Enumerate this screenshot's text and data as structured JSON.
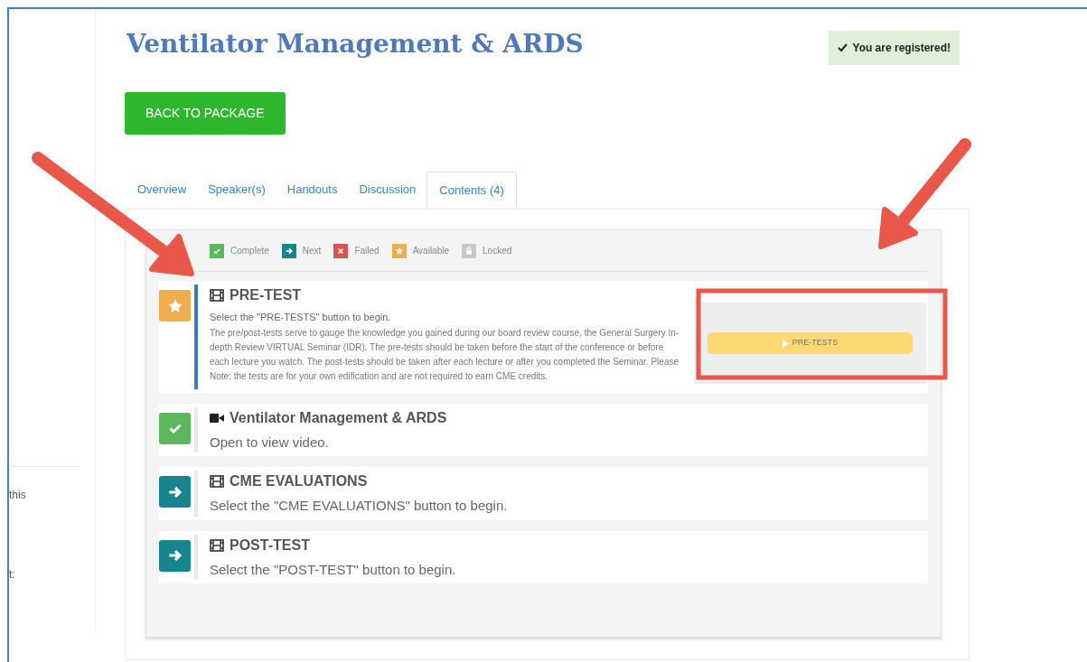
{
  "sidebar": {
    "fragments": [
      "this",
      "t:"
    ]
  },
  "title": "Ventilator Management & ARDS",
  "registration": {
    "label": "You are registered!"
  },
  "back_button": "BACK TO PACKAGE",
  "tabs": [
    {
      "label": "Overview",
      "selected": false
    },
    {
      "label": "Speaker(s)",
      "selected": false
    },
    {
      "label": "Handouts",
      "selected": false
    },
    {
      "label": "Discussion",
      "selected": false
    },
    {
      "label": "Contents (4)",
      "selected": true
    }
  ],
  "legend": [
    {
      "kind": "complete",
      "label": "Complete"
    },
    {
      "kind": "next",
      "label": "Next"
    },
    {
      "kind": "failed",
      "label": "Failed"
    },
    {
      "kind": "available",
      "label": "Available"
    },
    {
      "kind": "locked",
      "label": "Locked"
    }
  ],
  "items": [
    {
      "kind": "available",
      "media": {
        "kind": "film"
      },
      "title": "PRE-TEST",
      "subtitle": "Select the \"PRE-TESTS\" button to begin.",
      "description": "The pre/post-tests serve to gauge the knowledge you gained during our board review course, the General Surgery In-depth Review VIRTUAL Seminar (IDR). The pre-tests should be taken before the start of the conference or before each lecture you watch. The post-tests should be taken after each lecture or after you completed the Seminar. Please Note: the tests are for your own edification and are not required to earn CME credits.",
      "action": "PRE-TESTS",
      "highlighted": true
    },
    {
      "kind": "complete",
      "media": {
        "kind": "video"
      },
      "title": "Ventilator Management & ARDS",
      "subtitle": "Open to view video.",
      "highlighted": false
    },
    {
      "kind": "next",
      "media": {
        "kind": "film"
      },
      "title": "CME EVALUATIONS",
      "subtitle": "Select the \"CME EVALUATIONS\" button to begin.",
      "highlighted": false
    },
    {
      "kind": "next",
      "media": {
        "kind": "film"
      },
      "title": "POST-TEST",
      "subtitle": "Select the \"POST-TEST\" button to begin.",
      "highlighted": false
    }
  ]
}
